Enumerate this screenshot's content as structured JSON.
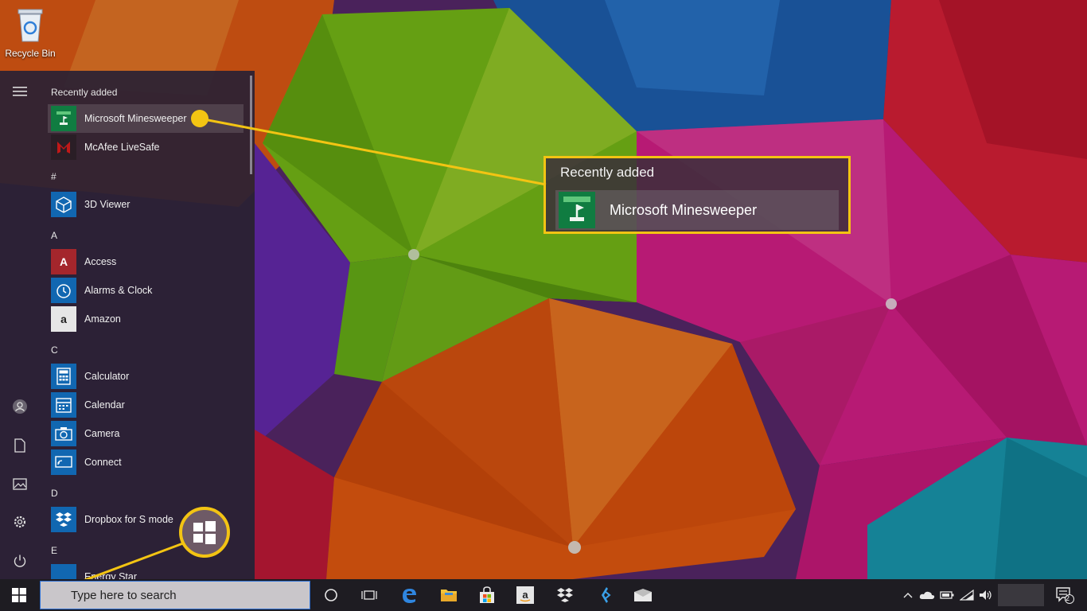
{
  "desktop": {
    "recycle_bin_label": "Recycle Bin"
  },
  "start_menu": {
    "rail_icons": [
      "hamburger-menu-icon",
      "user-icon",
      "documents-icon",
      "pictures-icon",
      "settings-icon",
      "power-icon"
    ],
    "sections": {
      "recently_added": "Recently added",
      "hash": "#",
      "a": "A",
      "c": "C",
      "d": "D",
      "e": "E"
    },
    "apps": {
      "minesweeper": "Microsoft Minesweeper",
      "mcafee": "McAfee LiveSafe",
      "viewer3d": "3D Viewer",
      "access": "Access",
      "alarms": "Alarms & Clock",
      "amazon": "Amazon",
      "calculator": "Calculator",
      "calendar": "Calendar",
      "camera": "Camera",
      "connect": "Connect",
      "dropbox": "Dropbox for S mode",
      "energy": "Energy Star"
    },
    "tile_glyphs": {
      "access": "A",
      "amazon": "a"
    }
  },
  "callout": {
    "heading": "Recently added",
    "item_label": "Microsoft Minesweeper"
  },
  "taskbar": {
    "search_placeholder": "Type here to search",
    "pinned_icons": [
      "cortana-icon",
      "task-view-icon",
      "edge-icon",
      "file-explorer-icon",
      "store-icon",
      "amazon-icon",
      "dropbox-icon",
      "visual-studio-icon",
      "mail-icon"
    ],
    "tray_icons": [
      "chevron-up-icon",
      "onedrive-icon",
      "battery-icon",
      "wifi-icon",
      "volume-icon"
    ],
    "notification_count": "2"
  },
  "colors": {
    "accent_yellow": "#f3c413",
    "minesweeper_green": "#107c41",
    "mcafee_red": "#c01818",
    "tile_blue": "#1167b1",
    "access_red": "#a4262c"
  }
}
